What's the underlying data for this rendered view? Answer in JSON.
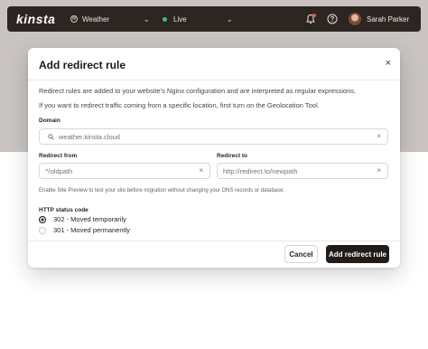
{
  "topbar": {
    "logo": "kinsta",
    "site_name": "Weather",
    "environment": "Live",
    "user_name": "Sarah Parker",
    "icons": [
      "wordpress-icon",
      "chevron-down-icon",
      "bell-icon",
      "help-icon"
    ]
  },
  "modal": {
    "title": "Add redirect rule",
    "close_symbol": "×",
    "description_1": "Redirect rules are added to your website's Nginx configuration and are interpreted as regular expressions.",
    "description_2": "If you want to redirect traffic coming from a specific location, first turn on the Geolocation Tool.",
    "domain": {
      "label": "Domain",
      "value": "weather.kinsta.cloud"
    },
    "redirect_from": {
      "label": "Redirect from",
      "value": "^/oldpath"
    },
    "redirect_to": {
      "label": "Redirect to",
      "value": "http://redirect.to/newpath"
    },
    "hint": "Enable Site Preview to test your site before migration without changing your DNS records or database.",
    "status": {
      "label": "HTTP status code",
      "options": [
        {
          "label": "302 - Moved temporarily",
          "selected": true
        },
        {
          "label": "301 - Moved permanently",
          "selected": false
        }
      ]
    },
    "cancel_label": "Cancel",
    "submit_label": "Add redirect rule"
  },
  "colors": {
    "topbar_bg": "#2d2522",
    "backdrop": "#c9c4c1",
    "primary_button": "#221b18",
    "live_dot": "#3fbf7a",
    "notification_dot": "#e85a4f"
  }
}
